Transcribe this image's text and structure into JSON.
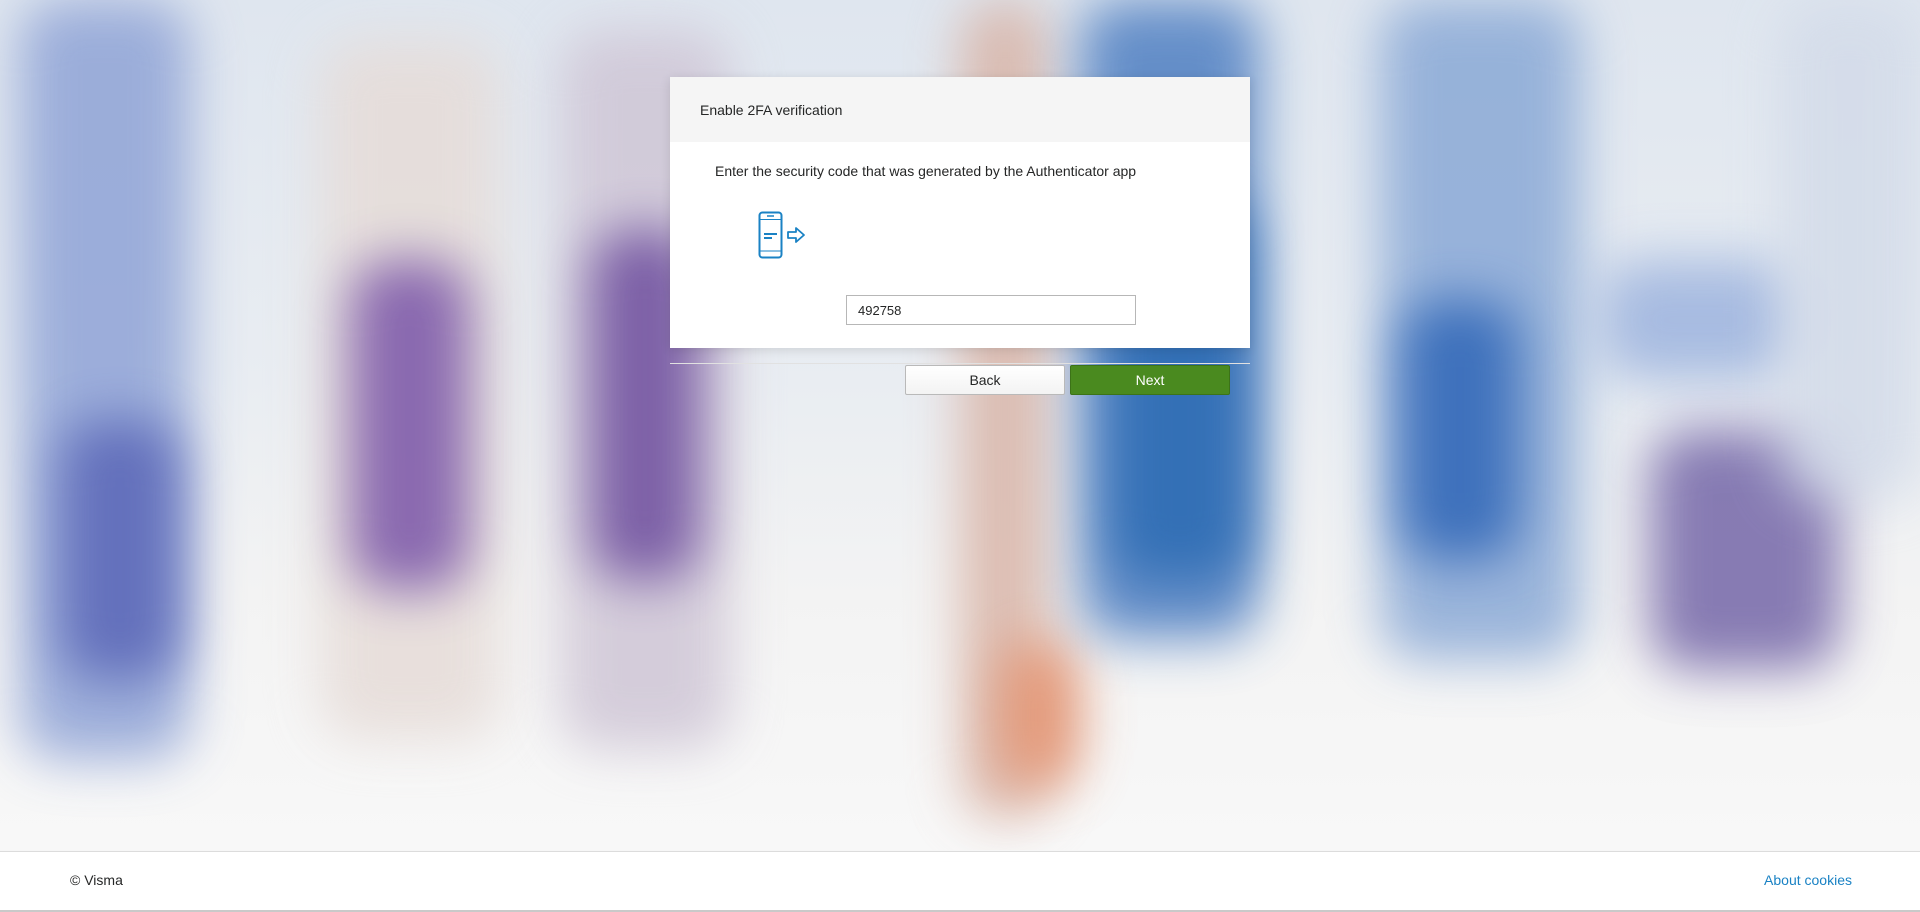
{
  "dialog": {
    "title": "Enable 2FA verification",
    "instruction": "Enter the security code that was generated by the Authenticator app",
    "icon": "phone-arrow-icon",
    "code_value": "492758",
    "back_label": "Back",
    "next_label": "Next"
  },
  "footer": {
    "copyright": "© Visma",
    "about_cookies": "About cookies"
  },
  "colors": {
    "primary_button": "#4a8a1f",
    "link": "#1a82c4",
    "icon": "#1a82c4"
  }
}
